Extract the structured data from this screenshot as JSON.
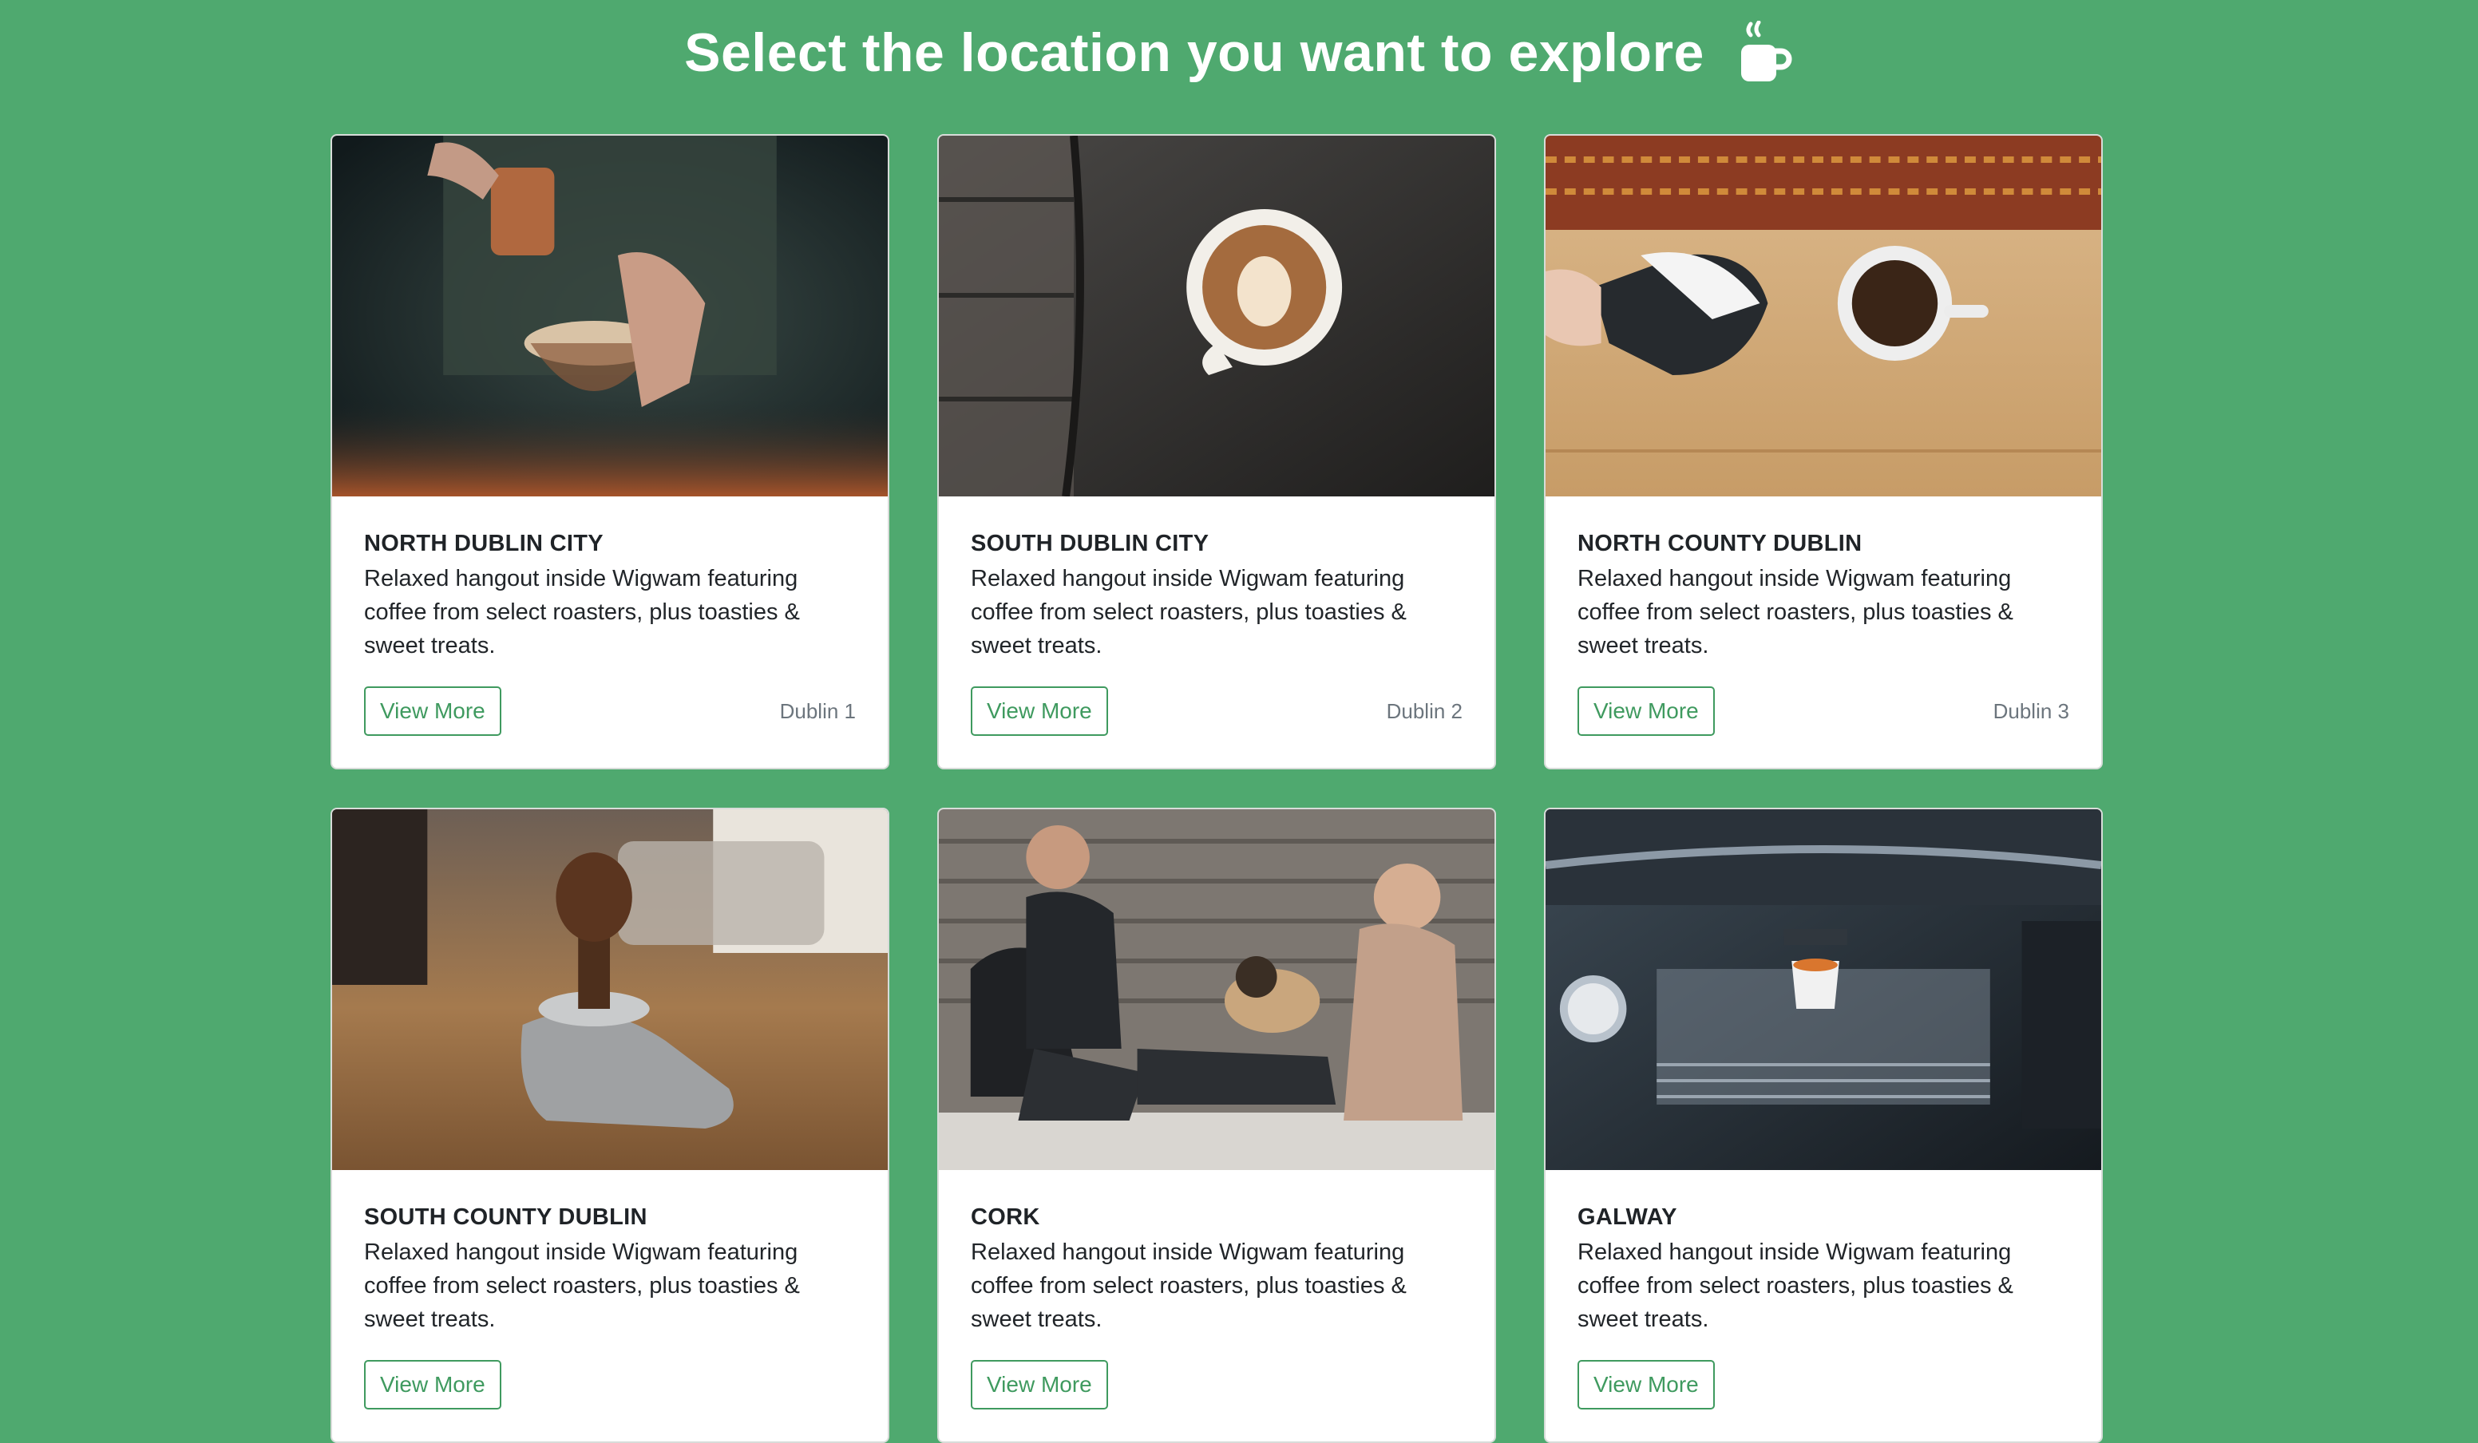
{
  "header": {
    "title": "Select the location you want to explore",
    "icon": "coffee-cup-icon"
  },
  "colors": {
    "background": "#4fa96f",
    "accent": "#3f9a5f",
    "card": "#ffffff"
  },
  "cards": [
    {
      "title": "NORTH DUBLIN CITY",
      "description": "Relaxed hangout inside Wigwam featuring coffee from select roasters, plus toasties & sweet treats.",
      "button": "View More",
      "postcode": "Dublin 1",
      "image": "barista-pour-over-photo"
    },
    {
      "title": "SOUTH DUBLIN CITY",
      "description": "Relaxed hangout inside Wigwam featuring coffee from select roasters, plus toasties & sweet treats.",
      "button": "View More",
      "postcode": "Dublin 2",
      "image": "latte-art-on-wood-photo"
    },
    {
      "title": "NORTH COUNTY DUBLIN",
      "description": "Relaxed hangout inside Wigwam featuring coffee from select roasters, plus toasties & sweet treats.",
      "button": "View More",
      "postcode": "Dublin 3",
      "image": "milk-pouring-photo"
    },
    {
      "title": "SOUTH COUNTY DUBLIN",
      "description": "Relaxed hangout inside Wigwam featuring coffee from select roasters, plus toasties & sweet treats.",
      "button": "View More",
      "postcode": "",
      "image": "coffee-tamper-photo"
    },
    {
      "title": "CORK",
      "description": "Relaxed hangout inside Wigwam featuring coffee from select roasters, plus toasties & sweet treats.",
      "button": "View More",
      "postcode": "",
      "image": "couple-with-dog-photo"
    },
    {
      "title": "GALWAY",
      "description": "Relaxed hangout inside Wigwam featuring coffee from select roasters, plus toasties & sweet treats.",
      "button": "View More",
      "postcode": "",
      "image": "espresso-machine-photo"
    }
  ]
}
